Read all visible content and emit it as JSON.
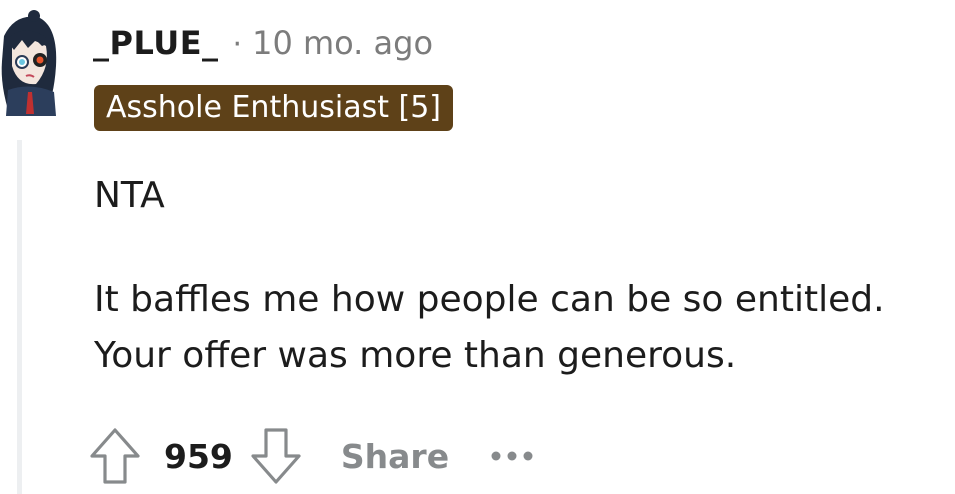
{
  "comment": {
    "username": "_PLUE_",
    "separator": "·",
    "timestamp": "10 mo. ago",
    "flair": "Asshole Enthusiast [5]",
    "flair_color": "#5e4118",
    "paragraphs": [
      "NTA",
      "It baffles me how people can be so entitled.",
      "Your offer was more than generous."
    ],
    "actions": {
      "upvote_icon": "arrow-up-icon",
      "score": "959",
      "downvote_icon": "arrow-down-icon",
      "share_label": "Share",
      "more_icon": "ellipsis-icon"
    }
  }
}
